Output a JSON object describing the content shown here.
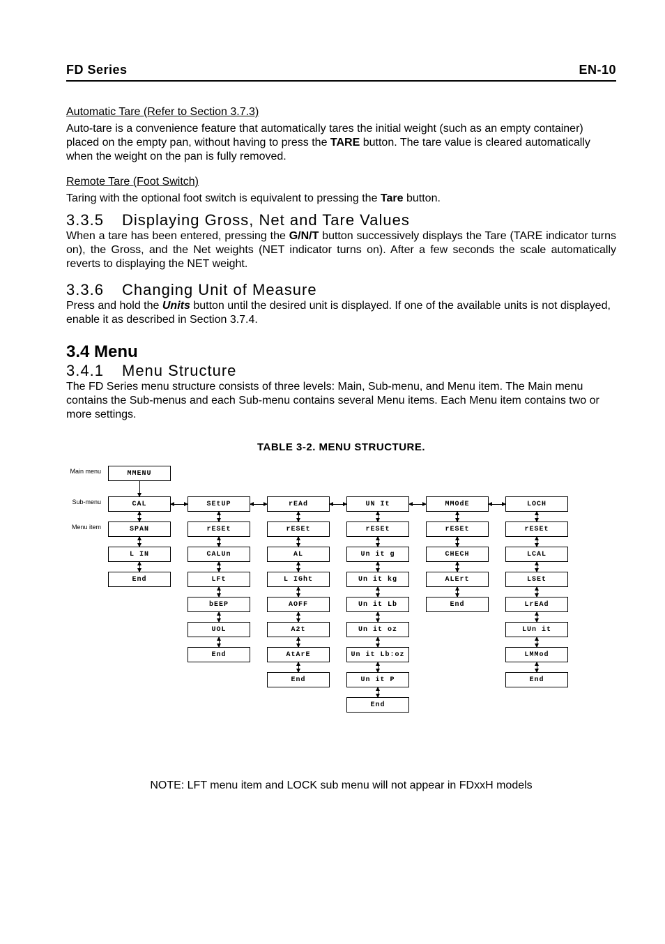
{
  "header": {
    "left": "FD Series",
    "right": "EN-10"
  },
  "sections": {
    "autoTare": {
      "title": "Automatic Tare (Refer to Section 3.7.3)",
      "p1a": "Auto-tare is a convenience feature that automatically tares the initial weight (such as an empty container) placed on the empty pan, without having to press the ",
      "btn": "TARE",
      "p1b": " button. The tare value is cleared automatically when the weight on the pan is fully removed."
    },
    "remoteTare": {
      "title": "Remote Tare (Foot Switch)",
      "p_a": "Taring with the optional foot switch is equivalent to pressing the ",
      "btn": "Tare",
      "p_b": " button."
    },
    "s335": {
      "num": "3.3.5",
      "title": "Displaying Gross, Net and Tare Values",
      "p_a": "When a tare has been entered, pressing the ",
      "btn": "G/N/T",
      "p_b": " button successively displays the Tare (TARE indicator turns on), the Gross, and the Net weights (NET indicator turns on).  After a few seconds the scale automatically reverts to displaying the NET weight."
    },
    "s336": {
      "num": "3.3.6",
      "title": "Changing Unit of Measure",
      "p_a": "Press and hold the ",
      "btn": "Units",
      "p_b": "  button until the desired unit is displayed.  If one of the available units is not displayed, enable it as described in Section 3.7.4."
    },
    "s34": {
      "title": "3.4 Menu"
    },
    "s341": {
      "num": "3.4.1",
      "title": "Menu Structure",
      "p": "The FD Series menu structure consists of three levels: Main, Sub-menu, and Menu item.  The Main menu contains the Sub-menus and each Sub-menu contains several Menu items.  Each Menu item contains two or more settings."
    },
    "tableTitle": "TABLE 3-2. MENU STRUCTURE.",
    "note": "NOTE: LFT menu item and LOCK sub menu will not appear in FDxxH models"
  },
  "diagram": {
    "sideLabels": {
      "main": "Main menu",
      "sub": "Sub-menu",
      "item": "Menu item"
    },
    "mainMenu": "MMENU",
    "columns": [
      {
        "sub": "CAL",
        "items": [
          "SPAN",
          "L IN",
          "End"
        ]
      },
      {
        "sub": "SEtUP",
        "items": [
          "rESEt",
          "CALUn",
          "LFt",
          "bEEP",
          "UOL",
          "End"
        ]
      },
      {
        "sub": "rEAd",
        "items": [
          "rESEt",
          "AL",
          "L IGht",
          "AOFF",
          "A2t",
          "AtArE",
          "End"
        ]
      },
      {
        "sub": "UN It",
        "items": [
          "rESEt",
          "Un it  g",
          "Un it  kg",
          "Un it  Lb",
          "Un it  oz",
          "Un it  Lb:oz",
          "Un it  P",
          "End"
        ]
      },
      {
        "sub": "MMOdE",
        "items": [
          "rESEt",
          "CHECH",
          "ALErt",
          "End"
        ]
      },
      {
        "sub": "LOCH",
        "items": [
          "rESEt",
          "LCAL",
          "LSEt",
          "LrEAd",
          "LUn it",
          "LMMod",
          "End"
        ]
      }
    ]
  }
}
